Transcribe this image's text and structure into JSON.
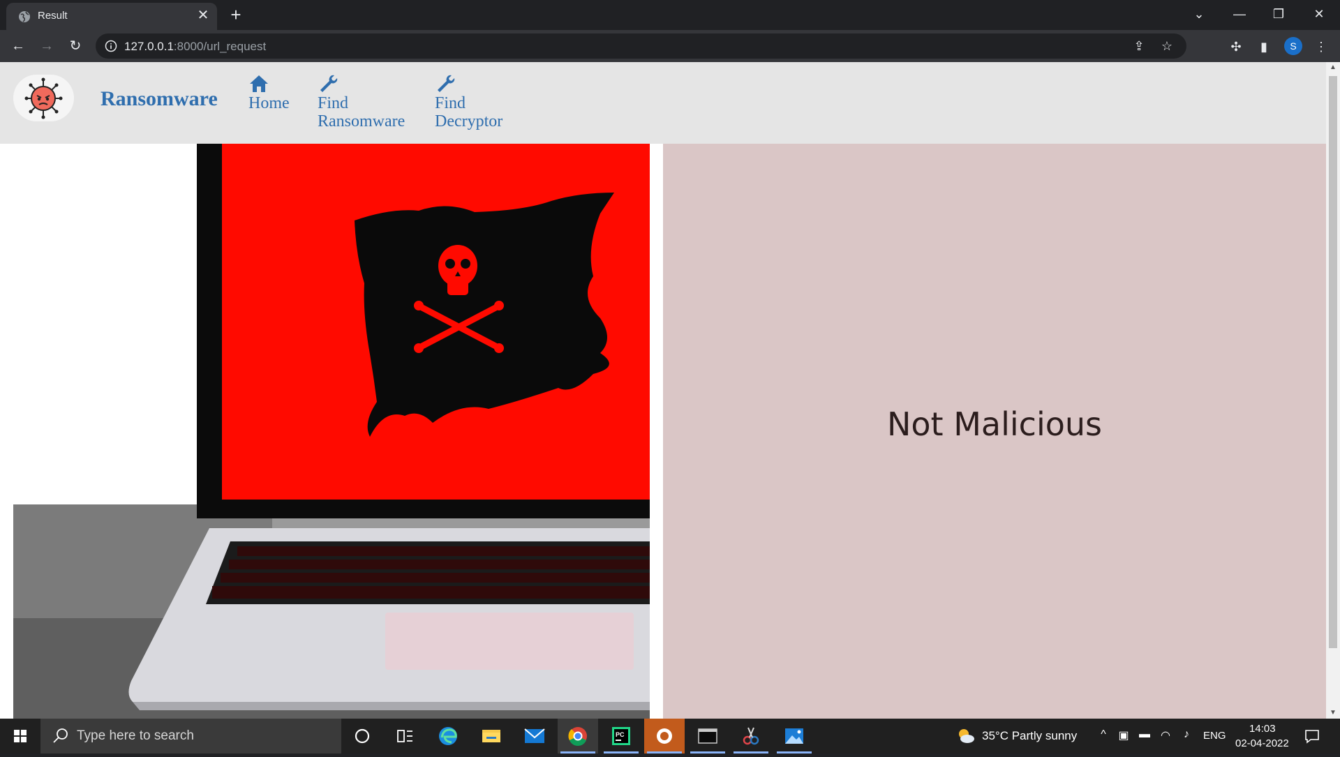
{
  "browser": {
    "tab_title": "Result",
    "url_host": "127.0.0.1",
    "url_rest": ":8000/url_request",
    "profile_initial": "S"
  },
  "navbar": {
    "brand": "Ransomware",
    "items": [
      {
        "label_line1": "Home",
        "label_line2": "",
        "icon": "home-icon"
      },
      {
        "label_line1": "Find",
        "label_line2": "Ransomware",
        "icon": "wrench-icon"
      },
      {
        "label_line1": "Find",
        "label_line2": "Decryptor",
        "icon": "wrench-icon"
      }
    ]
  },
  "result": {
    "verdict": "Not Malicious"
  },
  "colors": {
    "brand_blue": "#2f6eae",
    "result_panel": "#dac6c6",
    "hero_red": "#ff0a00"
  },
  "taskbar": {
    "search_placeholder": "Type here to search",
    "weather": "35°C  Partly sunny",
    "language": "ENG",
    "time": "14:03",
    "date": "02-04-2022"
  }
}
